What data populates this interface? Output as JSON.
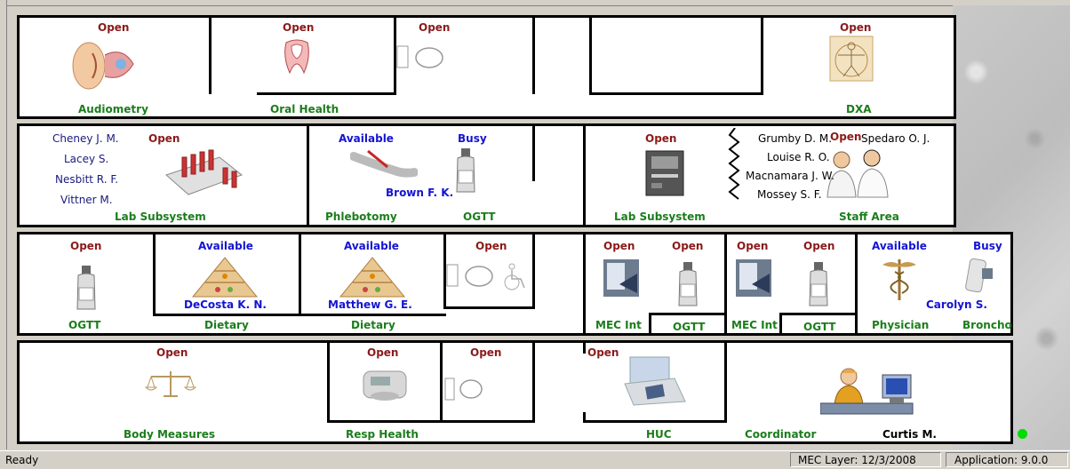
{
  "statusbar": {
    "left": "Ready",
    "layer": "MEC Layer: 12/3/2008",
    "app": "Application: 9.0.0"
  },
  "row1": {
    "audiometry": {
      "status": "Open",
      "label": "Audiometry"
    },
    "oral_health": {
      "status": "Open",
      "label": "Oral Health"
    },
    "exam_room": {
      "status": "Open"
    },
    "dxa": {
      "status": "Open",
      "label": "DXA"
    }
  },
  "row2": {
    "lab_staff": [
      "Cheney J. M.",
      "Lacey S.",
      "Nesbitt R. F.",
      "Vittner M."
    ],
    "lab1": {
      "status": "Open",
      "label": "Lab Subsystem"
    },
    "phlebotomy": {
      "status": "Available",
      "label": "Phlebotomy",
      "person": "Brown F. K."
    },
    "ogtt1": {
      "status": "Busy",
      "label": "OGTT"
    },
    "lab2": {
      "status": "Open",
      "label": "Lab Subsystem"
    },
    "staff_area": {
      "status": "Open",
      "label": "Staff Area"
    },
    "staff_people": [
      "Grumby D. M.",
      "Spedaro O. J.",
      "Louise R. O.",
      "Macnamara J. W.",
      "Mossey S. F."
    ]
  },
  "row3": {
    "ogtt": {
      "status": "Open",
      "label": "OGTT"
    },
    "dietary1": {
      "status": "Available",
      "label": "Dietary",
      "person": "DeCosta K. N."
    },
    "dietary2": {
      "status": "Available",
      "label": "Dietary",
      "person": "Matthew G. E."
    },
    "exam_room2": {
      "status": "Open"
    },
    "mec_int1": {
      "status": "Open",
      "label": "MEC Int"
    },
    "ogtt2": {
      "status": "Open",
      "label": "OGTT"
    },
    "mec_int2": {
      "status": "Open",
      "label": "MEC Int"
    },
    "ogtt3": {
      "status": "Open",
      "label": "OGTT"
    },
    "physician": {
      "status": "Available",
      "label": "Physician",
      "person": "Carolyn S."
    },
    "broncho": {
      "status": "Busy",
      "label": "Broncho"
    }
  },
  "row4": {
    "body_measures": {
      "status": "Open",
      "label": "Body Measures"
    },
    "resp_health": {
      "status": "Open",
      "label": "Resp Health"
    },
    "exam_room3": {
      "status": "Open"
    },
    "huc": {
      "status": "Open",
      "label": "HUC"
    },
    "coordinator": {
      "label": "Coordinator",
      "person": "Curtis M."
    },
    "status_light_color": "#00dd00"
  }
}
